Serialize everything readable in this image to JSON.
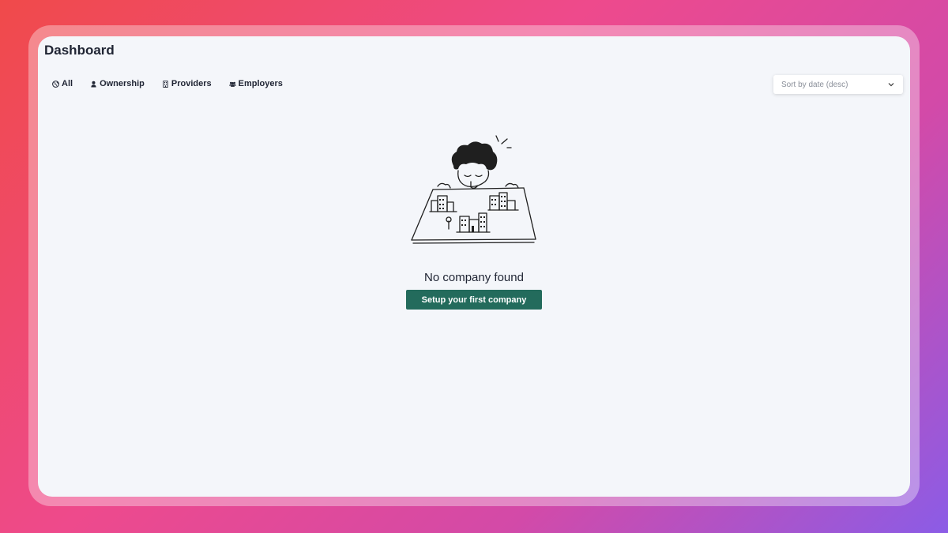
{
  "page": {
    "title": "Dashboard"
  },
  "tabs": [
    {
      "label": "All",
      "icon": "globe-icon"
    },
    {
      "label": "Ownership",
      "icon": "user-icon"
    },
    {
      "label": "Providers",
      "icon": "building-icon"
    },
    {
      "label": "Employers",
      "icon": "users-icon"
    }
  ],
  "sort": {
    "selected": "Sort by date (desc)",
    "icon": "chevron-down-icon"
  },
  "empty_state": {
    "illustration": "person-looking-at-city-illustration",
    "message": "No company found",
    "button_label": "Setup your first company"
  },
  "colors": {
    "accent": "#236b5c",
    "background": "#f4f6fa",
    "text": "#1f2433"
  }
}
